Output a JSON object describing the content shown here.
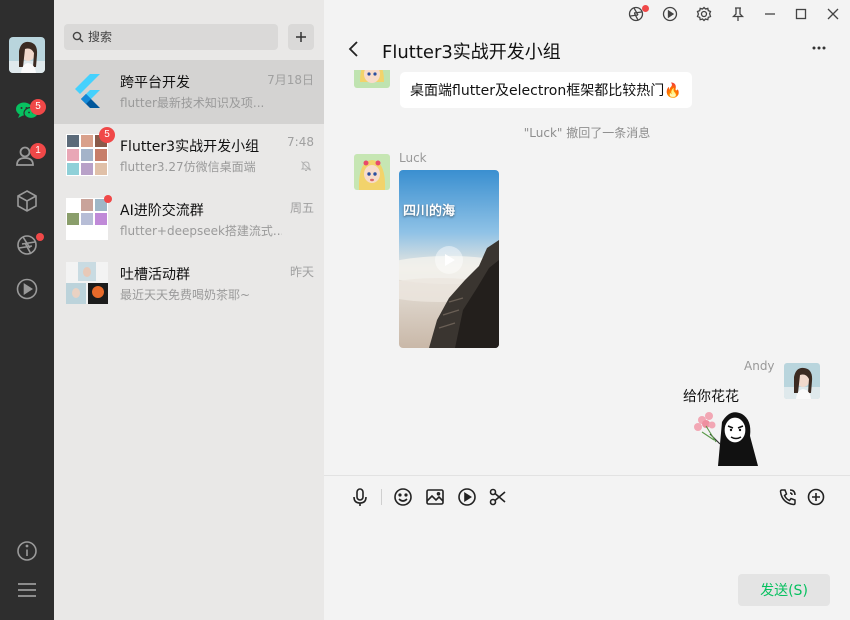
{
  "colors": {
    "accent": "#07c160",
    "badge": "#f04848",
    "rail": "#2e2e2e"
  },
  "rail": {
    "chat_badge": "5",
    "contacts_badge": "1"
  },
  "search": {
    "placeholder": "搜索"
  },
  "conversations": [
    {
      "title": "跨平台开发",
      "preview": "flutter最新技术知识及项...",
      "time": "7月18日"
    },
    {
      "title": "Flutter3实战开发小组",
      "preview": "flutter3.27仿微信桌面端",
      "time": "7:48",
      "badge": "5"
    },
    {
      "title": "AI进阶交流群",
      "preview": "flutter+deepseek搭建流式...",
      "time": "周五"
    },
    {
      "title": "吐槽活动群",
      "preview": "最近天天免费喝奶茶耶~",
      "time": "昨天"
    }
  ],
  "chat": {
    "title": "Flutter3实战开发小组",
    "messages": {
      "m1_text": "桌面端flutter及electron框架都比较热门🔥",
      "recall_notice": "\"Luck\" 撤回了一条消息",
      "m2_sender": "Luck",
      "m2_video_caption": "四川的海",
      "m3_sender": "Andy",
      "m3_text": "给你花花"
    },
    "send_label": "发送(S)"
  }
}
